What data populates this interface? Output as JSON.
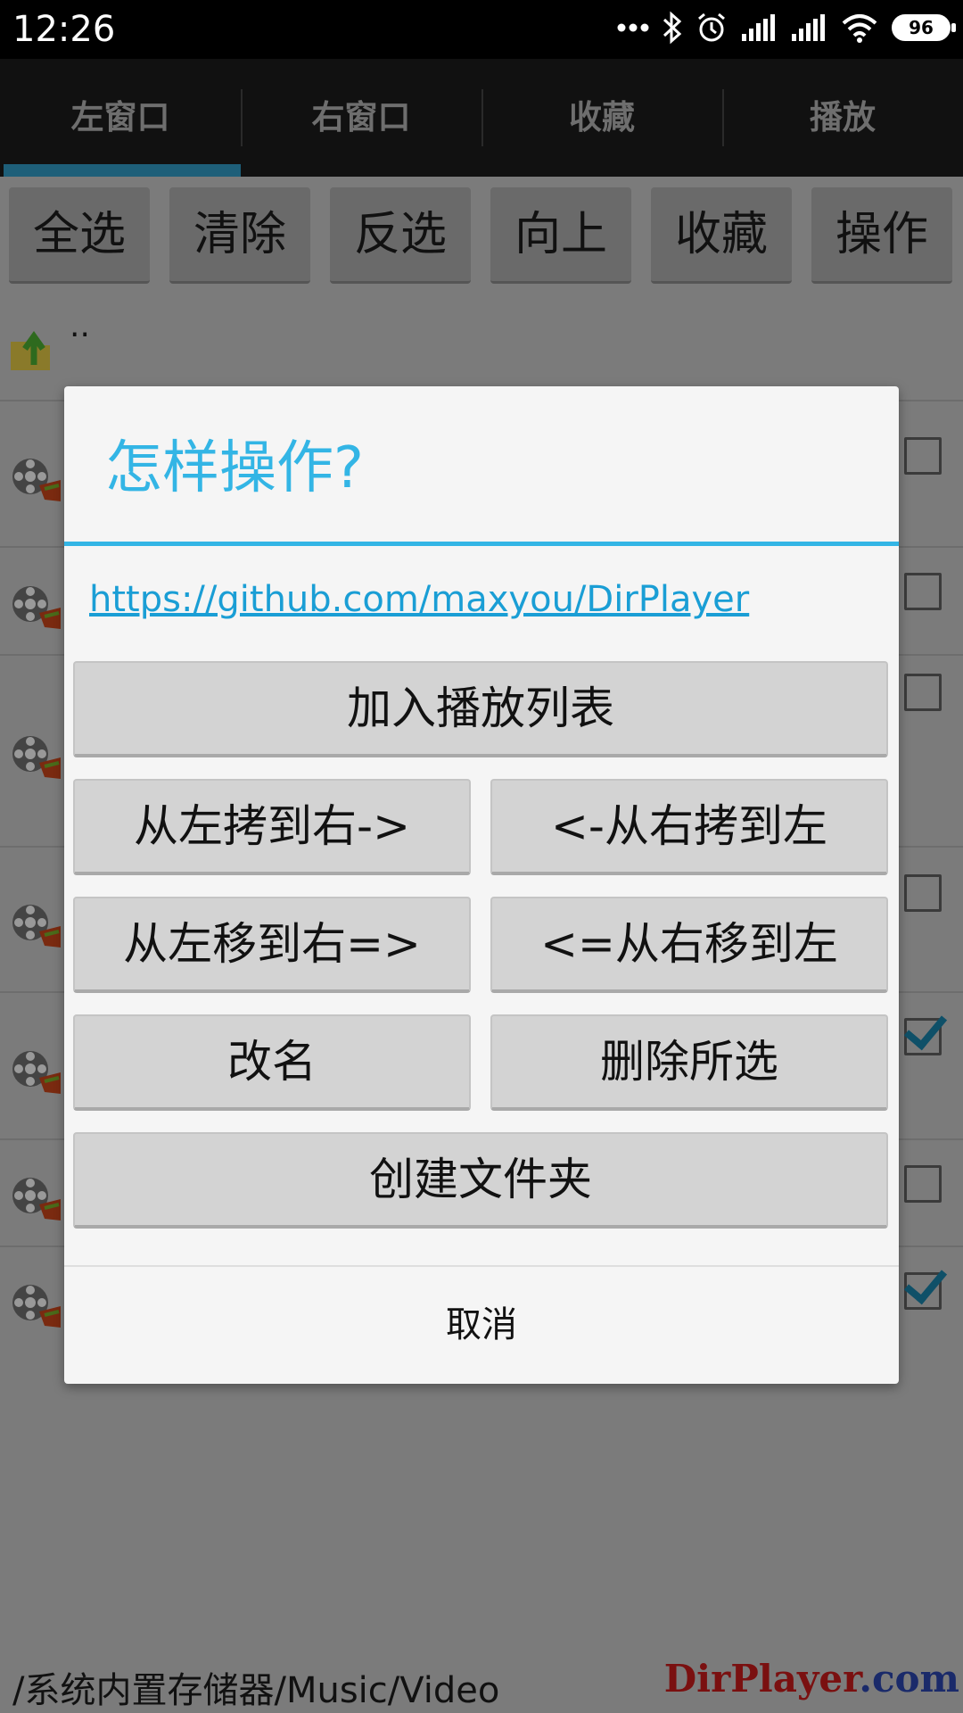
{
  "status_bar": {
    "time": "12:26",
    "battery": "96",
    "icons": [
      "more-dots-icon",
      "bluetooth-icon",
      "alarm-icon",
      "signal-icon",
      "signal-icon",
      "wifi-icon",
      "battery-icon"
    ]
  },
  "tabs": [
    {
      "label": "左窗口",
      "active": true
    },
    {
      "label": "右窗口",
      "active": false
    },
    {
      "label": "收藏",
      "active": false
    },
    {
      "label": "播放",
      "active": false
    }
  ],
  "toolbar": [
    "全选",
    "清除",
    "反选",
    "向上",
    "收藏",
    "操作"
  ],
  "file_list": {
    "up_label": "..",
    "rows": [
      {
        "checked": false
      },
      {
        "checked": false
      },
      {
        "checked": false
      },
      {
        "checked": false
      },
      {
        "checked": true
      },
      {
        "checked": false
      },
      {
        "checked": true
      }
    ]
  },
  "dialog": {
    "title": "怎样操作?",
    "link": "https://github.com/maxyou/DirPlayer",
    "add_to_playlist": "加入播放列表",
    "copy_left_to_right": "从左拷到右->",
    "copy_right_to_left": "<-从右拷到左",
    "move_left_to_right": "从左移到右=>",
    "move_right_to_left": "<=从右移到左",
    "rename": "改名",
    "delete_selected": "删除所选",
    "create_folder": "创建文件夹",
    "cancel": "取消"
  },
  "path": "/系统内置存储器/Music/Video",
  "watermark": {
    "main": "DirPlayer",
    "suffix": ".com"
  },
  "colors": {
    "accent": "#33b5e5",
    "tab_indicator": "#1e5f79",
    "link": "#1a9ed5"
  }
}
